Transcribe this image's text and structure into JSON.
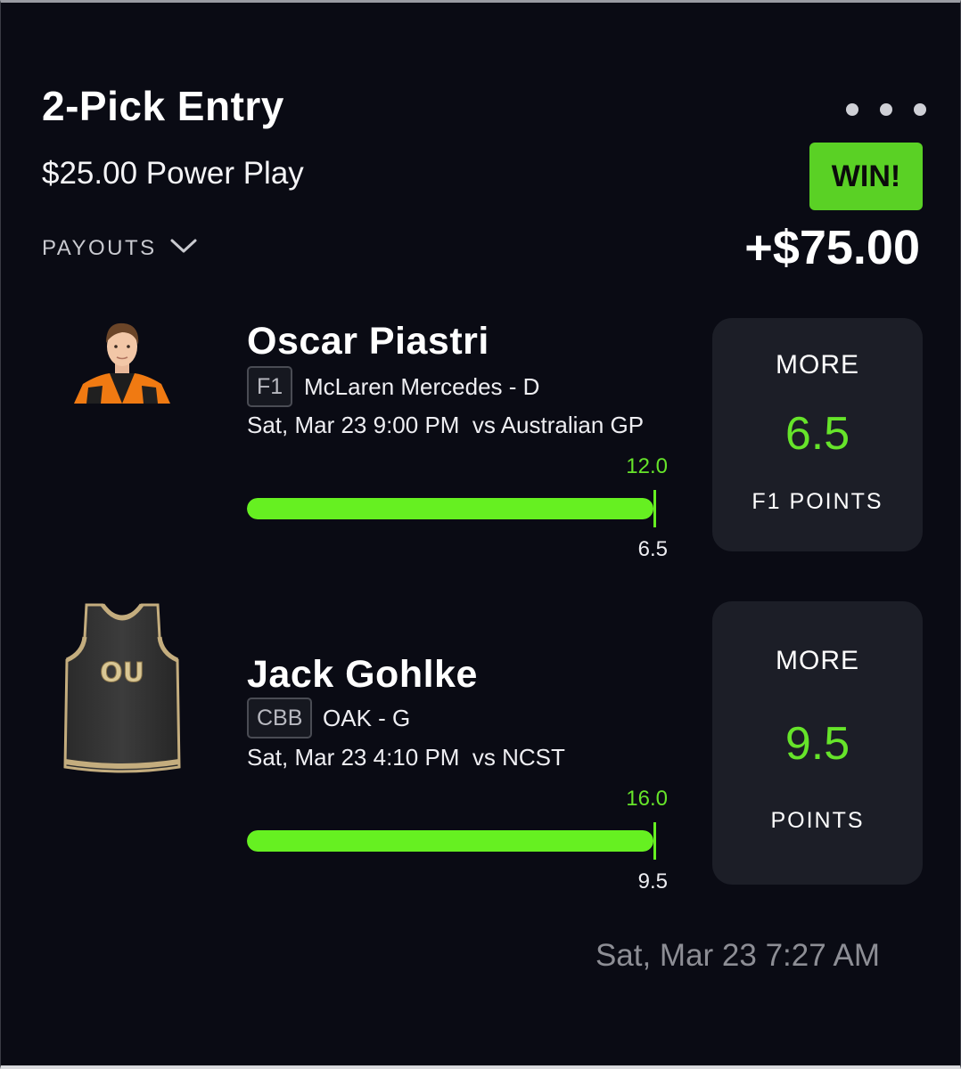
{
  "entry": {
    "title": "2-Pick Entry",
    "subtitle": "$25.00 Power Play",
    "payouts_label": "PAYOUTS",
    "result_badge": "WIN!",
    "payout_amount": "+$75.00",
    "win_color": "#5ad125"
  },
  "picks": [
    {
      "player_name": "Oscar Piastri",
      "league": "F1",
      "team": "McLaren Mercedes - D",
      "game_time": "Sat, Mar 23 9:00 PM",
      "opponent": "vs Australian GP",
      "actual_value": "12.0",
      "line_value": "6.5",
      "progress_fraction": 1.0,
      "direction": "MORE",
      "projection": "6.5",
      "stat_type": "F1 POINTS",
      "avatar_icon": "driver-portrait-icon"
    },
    {
      "player_name": "Jack Gohlke",
      "league": "CBB",
      "team": "OAK - G",
      "game_time": "Sat, Mar 23 4:10 PM",
      "opponent": "vs NCST",
      "actual_value": "16.0",
      "line_value": "9.5",
      "progress_fraction": 1.0,
      "direction": "MORE",
      "projection": "9.5",
      "stat_type": "POINTS",
      "avatar_icon": "jersey-icon",
      "jersey_text": "OU"
    }
  ],
  "footer": {
    "timestamp": "Sat, Mar 23 7:27 AM"
  }
}
